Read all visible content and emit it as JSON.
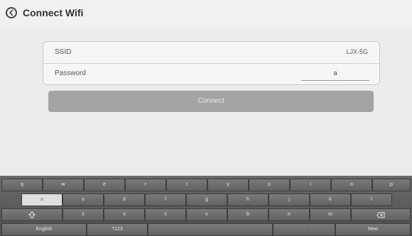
{
  "header": {
    "title": "Connect Wifi"
  },
  "form": {
    "ssid_label": "SSID",
    "ssid_value": "LJX-5G",
    "password_label": "Password",
    "password_value": "a"
  },
  "connect_label": "Connect",
  "keyboard": {
    "row1": [
      "q",
      "w",
      "e",
      "r",
      "t",
      "y",
      "u",
      "i",
      "o",
      "p"
    ],
    "row2": [
      "a",
      "s",
      "d",
      "f",
      "g",
      "h",
      "j",
      "k",
      "l"
    ],
    "row3": [
      "z",
      "x",
      "c",
      "v",
      "b",
      "n",
      "m"
    ],
    "bottom": {
      "lang": "English",
      "sym": "?123",
      "space": "",
      "comma": ",",
      "next": "Next"
    }
  }
}
